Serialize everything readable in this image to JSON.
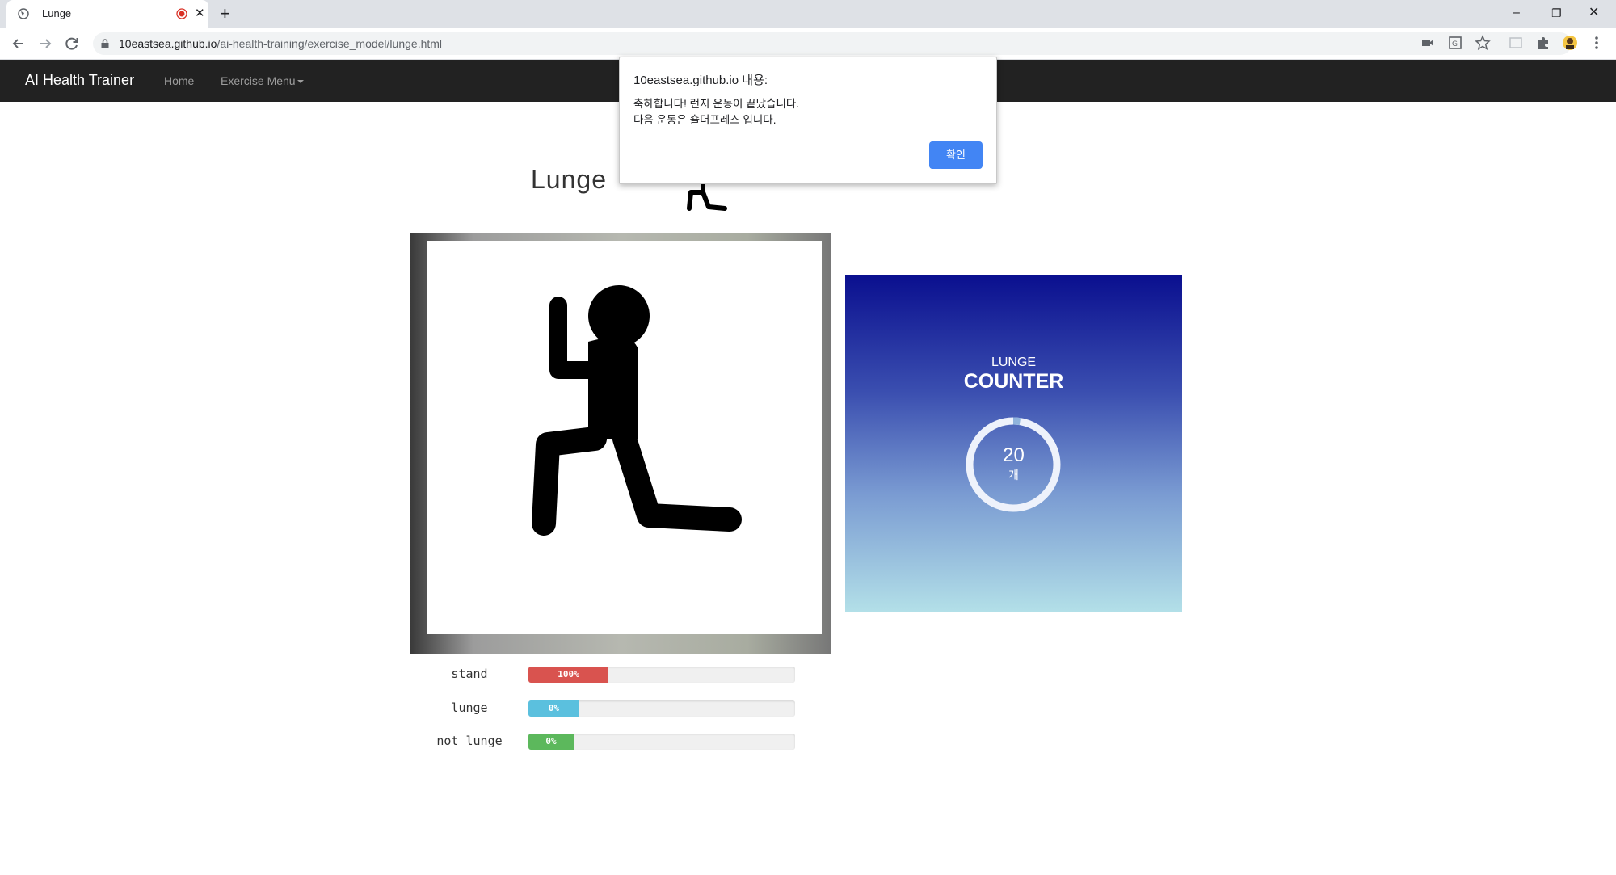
{
  "browser": {
    "tab_title": "Lunge",
    "url_host": "10eastsea.github.io",
    "url_path": "/ai-health-training/exercise_model/lunge.html"
  },
  "site": {
    "brand": "AI Health Trainer",
    "nav": {
      "home": "Home",
      "exercise_menu": "Exercise Menu"
    }
  },
  "page": {
    "heading": "Lunge"
  },
  "counter": {
    "small_label": "LUNGE",
    "big_label": "COUNTER",
    "count": "20",
    "unit": "개",
    "progress_fraction": 0.05
  },
  "predictions": [
    {
      "label": "stand",
      "percent_text": "100%",
      "fraction": 0.3,
      "color": "#d9534f"
    },
    {
      "label": "lunge",
      "percent_text": "0%",
      "fraction": 0.19,
      "color": "#5bc0de"
    },
    {
      "label": "not lunge",
      "percent_text": "0%",
      "fraction": 0.17,
      "color": "#5cb85c"
    }
  ],
  "dialog": {
    "title": "10eastsea.github.io 내용:",
    "line1": "축하합니다! 런지 운동이 끝났습니다.",
    "line2": "다음 운동은 숄더프레스 입니다.",
    "ok_label": "확인"
  },
  "colors": {
    "brand_blue": "#4285f4",
    "navbar_bg": "#222222",
    "counter_top": "#0a0f8f",
    "counter_bottom": "#b3e0e8"
  }
}
